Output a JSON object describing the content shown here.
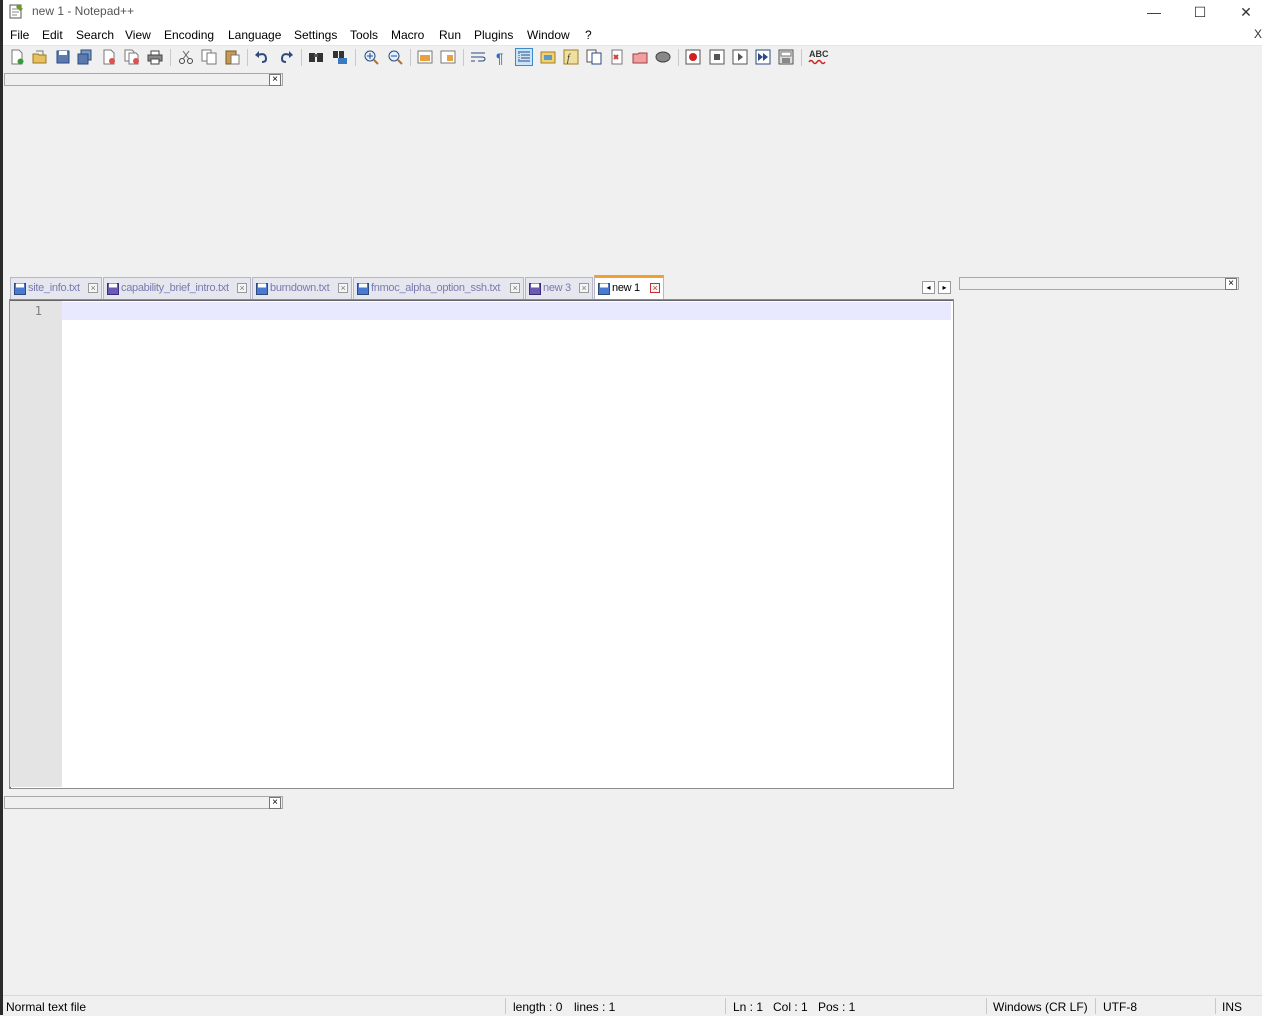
{
  "window": {
    "title": "new 1 - Notepad++",
    "minimize_glyph": "—",
    "maximize_glyph": "☐",
    "close_glyph": "✕"
  },
  "menu": {
    "items": [
      "File",
      "Edit",
      "Search",
      "View",
      "Encoding",
      "Language",
      "Settings",
      "Tools",
      "Macro",
      "Run",
      "Plugins",
      "Window",
      "?"
    ],
    "close_glyph": "X"
  },
  "toolbar": {
    "icons": [
      "new-file-icon",
      "open-file-icon",
      "save-icon",
      "save-all-icon",
      "close-icon",
      "close-all-icon",
      "print-icon",
      "cut-icon",
      "copy-icon",
      "paste-icon",
      "undo-icon",
      "redo-icon",
      "find-icon",
      "replace-icon",
      "zoom-in-icon",
      "zoom-out-icon",
      "sync-vertical-icon",
      "sync-horizontal-icon",
      "word-wrap-icon",
      "show-all-characters-icon",
      "indent-guide-icon",
      "folder-as-workspace-icon",
      "function-list-icon",
      "document-map-icon",
      "document-list-icon",
      "file-browser-icon",
      "monitoring-icon",
      "record-macro-icon",
      "stop-macro-icon",
      "play-macro-icon",
      "run-macro-multiple-icon",
      "save-macro-icon",
      "spell-check-icon"
    ],
    "spellcheck_text": "ABC"
  },
  "panels": {
    "close_glyph": "×"
  },
  "tabs": [
    {
      "label": "site_info.txt",
      "active": false
    },
    {
      "label": "capability_brief_intro.txt",
      "active": false
    },
    {
      "label": "burndown.txt",
      "active": false
    },
    {
      "label": "fnmoc_alpha_option_ssh.txt",
      "active": false
    },
    {
      "label": "new 3",
      "active": false
    },
    {
      "label": "new 1",
      "active": true
    }
  ],
  "tab_scroll": {
    "left": "◂",
    "right": "▸"
  },
  "editor": {
    "line_numbers": [
      "1"
    ],
    "content": ""
  },
  "status": {
    "file_type": "Normal text file",
    "length": "length : 0",
    "lines": "lines : 1",
    "ln": "Ln : 1",
    "col": "Col : 1",
    "pos": "Pos : 1",
    "eol": "Windows (CR LF)",
    "encoding": "UTF-8",
    "mode": "INS"
  },
  "colors": {
    "active_tab_accent": "#f0a030",
    "current_line": "#e8e8ff",
    "gutter": "#e4e4e4"
  }
}
